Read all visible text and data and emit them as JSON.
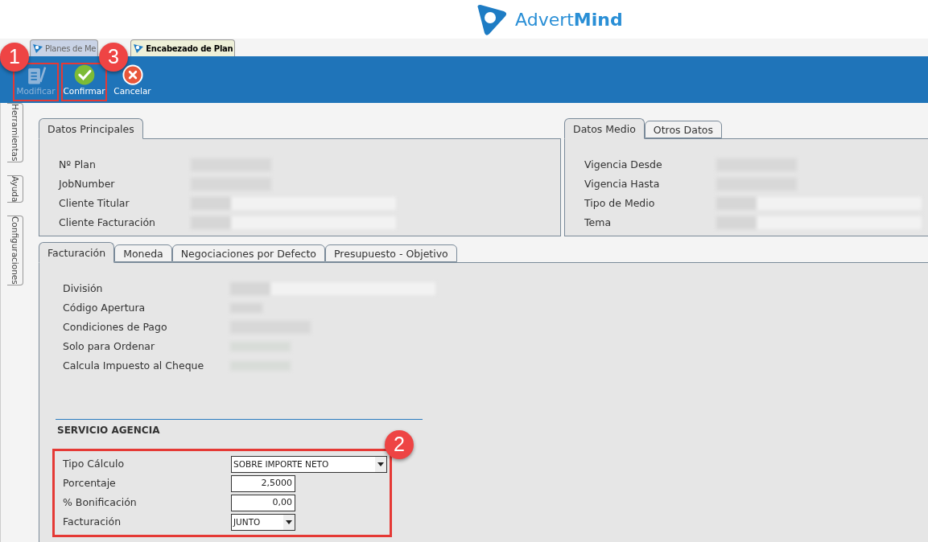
{
  "logo": {
    "text_light": "Advert",
    "text_bold": "Mind"
  },
  "document_tabs": [
    {
      "label": "Planes de Me",
      "selected": false
    },
    {
      "label": "Encabezado de Plan",
      "selected": true
    }
  ],
  "toolbar": [
    {
      "label": "Modificar",
      "kind": "edit",
      "disabled": true,
      "callout": "1"
    },
    {
      "label": "Confirmar",
      "kind": "confirm",
      "disabled": false,
      "callout": "3"
    },
    {
      "label": "Cancelar",
      "kind": "cancel",
      "disabled": false
    }
  ],
  "side_tabs": [
    "Herramientas",
    "Ayuda",
    "Configuraciones"
  ],
  "main_panel": {
    "tabs": [
      {
        "label": "Datos Principales",
        "selected": true
      }
    ],
    "fields": [
      {
        "label": "Nº Plan",
        "kind": "short"
      },
      {
        "label": "JobNumber",
        "kind": "short"
      },
      {
        "label": "Cliente Titular",
        "kind": "long"
      },
      {
        "label": "Cliente Facturación",
        "kind": "long"
      }
    ]
  },
  "media_panel": {
    "tabs": [
      {
        "label": "Datos Medio",
        "selected": true
      },
      {
        "label": "Otros Datos",
        "selected": false
      }
    ],
    "fields": [
      {
        "label": "Vigencia Desde",
        "kind": "short"
      },
      {
        "label": "Vigencia Hasta",
        "kind": "short"
      },
      {
        "label": "Tipo de Medio",
        "kind": "long"
      },
      {
        "label": "Tema",
        "kind": "long"
      }
    ]
  },
  "billing_panel": {
    "tabs": [
      {
        "label": "Facturación",
        "selected": true
      },
      {
        "label": "Moneda",
        "selected": false
      },
      {
        "label": "Negociaciones por Defecto",
        "selected": false
      },
      {
        "label": "Presupuesto - Objetivo",
        "selected": false
      }
    ],
    "fields": [
      {
        "label": "División",
        "kind": "long"
      },
      {
        "label": "Código Apertura",
        "kind": "tiny"
      },
      {
        "label": "Condiciones de Pago",
        "kind": "short"
      },
      {
        "label": "Solo para Ordenar",
        "kind": "radio"
      },
      {
        "label": "Calcula Impuesto al Cheque",
        "kind": "radio"
      }
    ],
    "service": {
      "title": "SERVICIO AGENCIA",
      "callout": "2",
      "fields": [
        {
          "label": "Tipo Cálculo",
          "kind": "select",
          "value": "SOBRE IMPORTE NETO",
          "wide": true
        },
        {
          "label": "Porcentaje",
          "kind": "number",
          "value": "2,5000",
          "wide": false
        },
        {
          "label": "% Bonificación",
          "kind": "number",
          "value": "0,00",
          "wide": false
        },
        {
          "label": "Facturación",
          "kind": "select",
          "value": "JUNTO",
          "wide": false
        }
      ]
    }
  }
}
